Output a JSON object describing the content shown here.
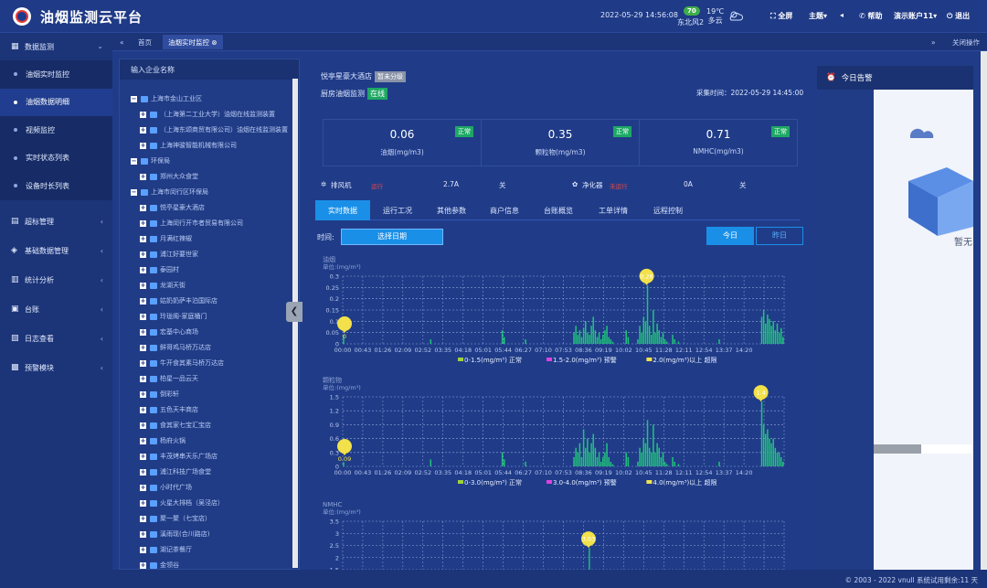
{
  "header": {
    "title": "油烟监测云平台",
    "datetime": "2022-05-29  14:56:08",
    "aqi": "70",
    "wind": "东北风2",
    "temperature": "19℃",
    "weather": "多云",
    "fullscreen": "全屏",
    "theme": "主题",
    "help": "帮助",
    "account": "演示账户11",
    "logout": "退出"
  },
  "sidebar": [
    {
      "label": "数据监测",
      "icon": "dashboard-icon",
      "expanded": true,
      "children": [
        "油烟实时监控",
        "油烟数据明细",
        "视频监控",
        "实时状态列表",
        "设备时长列表"
      ],
      "active_child": 1
    },
    {
      "label": "超标管理",
      "icon": "warning-icon"
    },
    {
      "label": "基础数据管理",
      "icon": "layers-icon"
    },
    {
      "label": "统计分析",
      "icon": "bar-chart-icon"
    },
    {
      "label": "台账",
      "icon": "ledger-icon"
    },
    {
      "label": "日志查看",
      "icon": "log-icon"
    },
    {
      "label": "预警模块",
      "icon": "alert-icon"
    }
  ],
  "tabs": {
    "home": "首页",
    "current": "油烟实时监控",
    "close_ops": "关闭操作"
  },
  "tree": {
    "placeholder": "输入企业名称",
    "nodes": [
      {
        "level": 0,
        "label": "上海市金山工业区",
        "type": "group"
      },
      {
        "level": 1,
        "label": "（上海第二工业大学）油烟在线监测装置"
      },
      {
        "level": 1,
        "label": "（上海东颂商贸有限公司）油烟在线监测装置"
      },
      {
        "level": 1,
        "label": "上海神骏智能机械有限公司"
      },
      {
        "level": 0,
        "label": "环保局",
        "type": "group"
      },
      {
        "level": 1,
        "label": "郑州大众食堂"
      },
      {
        "level": 0,
        "label": "上海市闵行区环保局",
        "type": "group"
      },
      {
        "level": 1,
        "label": "悦亭星豪大酒店"
      },
      {
        "level": 1,
        "label": "上海闵行开市者贸易有限公司"
      },
      {
        "level": 1,
        "label": "月满红辣椒"
      },
      {
        "level": 1,
        "label": "浦江好要世家"
      },
      {
        "level": 1,
        "label": "泰园村"
      },
      {
        "level": 1,
        "label": "龙湖天街"
      },
      {
        "level": 1,
        "label": "姑奶奶萨丰泊国际店"
      },
      {
        "level": 1,
        "label": "玲珑阁-家庭桶门"
      },
      {
        "level": 1,
        "label": "宏基中心商场"
      },
      {
        "level": 1,
        "label": "鲜哥鸡马桥万达店"
      },
      {
        "level": 1,
        "label": "牛开食其素马桥万达店"
      },
      {
        "level": 1,
        "label": "柏星一品云天"
      },
      {
        "level": 1,
        "label": "倒彩轩"
      },
      {
        "level": 1,
        "label": "五色天丰商店"
      },
      {
        "level": 1,
        "label": "食其家七宝汇宝店"
      },
      {
        "level": 1,
        "label": "杨府火锅"
      },
      {
        "level": 1,
        "label": "丰茂烤串天乐广场店"
      },
      {
        "level": 1,
        "label": "浦江科技广场食堂"
      },
      {
        "level": 1,
        "label": "小时代广场"
      },
      {
        "level": 1,
        "label": "火星大排档（吴泾店）"
      },
      {
        "level": 1,
        "label": "聚一聚（七宝店）"
      },
      {
        "level": 1,
        "label": "溪雨现(合川路店)"
      },
      {
        "level": 1,
        "label": "湖记茶餐厅"
      },
      {
        "level": 1,
        "label": "金领谷"
      }
    ]
  },
  "detail": {
    "site_name": "悦亭星豪大酒店",
    "site_badge": "暂未分级",
    "monitor_label": "厨房油烟监测",
    "monitor_status": "在线",
    "collect_time": "采集时间：2022-05-29 14:45:00",
    "metrics": [
      {
        "value": "0.06",
        "label": "油烟(mg/m3)",
        "status": "正常"
      },
      {
        "value": "0.35",
        "label": "颗粒物(mg/m3)",
        "status": "正常"
      },
      {
        "value": "0.71",
        "label": "NMHC(mg/m3)",
        "status": "正常"
      }
    ],
    "devices": {
      "fan_label": "排风机",
      "fan_status": "运行",
      "fan_current": "2.7A",
      "fan_switch": "关",
      "purifier_label": "净化器",
      "purifier_status": "未运行",
      "purifier_current": "0A",
      "purifier_switch": "关"
    },
    "tabs": [
      "实时数据",
      "运行工况",
      "其他参数",
      "商户信息",
      "台账概览",
      "工单详情",
      "远程控制"
    ],
    "time_label": "时间:",
    "date_button": "选择日期",
    "today": "今日",
    "yesterday": "昨日"
  },
  "alarm": {
    "title": "今日告警",
    "empty_text": "暂无"
  },
  "footer": {
    "copyright": "© 2003 - 2022  vnull   系统试用剩余:11 天"
  },
  "colors": {
    "bar": "#21c47c",
    "marker": "#f2e14a",
    "accent": "#1a8fe8"
  },
  "chart_data": [
    {
      "type": "bar",
      "title": "油烟",
      "ylabel": "单位:(mg/m³)",
      "ylim": [
        0,
        0.3
      ],
      "yticks": [
        "0.3",
        "0.25",
        "0.2",
        "0.15",
        "0.1",
        "0.05",
        "0"
      ],
      "categories": [
        "00:00",
        "00:43",
        "01:26",
        "02:09",
        "02:52",
        "03:35",
        "04:18",
        "05:01",
        "05:44",
        "06:27",
        "07:10",
        "07:53",
        "08:36",
        "09:19",
        "10:02",
        "10:45",
        "11:28",
        "12:11",
        "12:54",
        "13:37",
        "14:20"
      ],
      "max_label": "0.26",
      "min_label": "0",
      "legend": [
        {
          "label": "0-1.5(mg/m³) 正常",
          "color": "#9fd33c"
        },
        {
          "label": "1.5-2.0(mg/m³) 预警",
          "color": "#e040e0"
        },
        {
          "label": "2.0(mg/m³)以上 超限",
          "color": "#f2e14a"
        }
      ],
      "values": [
        0.04,
        0,
        0,
        0,
        0,
        0,
        0,
        0,
        0,
        0,
        0,
        0,
        0,
        0,
        0,
        0,
        0,
        0,
        0,
        0,
        0,
        0,
        0,
        0,
        0,
        0,
        0,
        0,
        0,
        0,
        0,
        0,
        0,
        0,
        0,
        0,
        0,
        0,
        0,
        0,
        0,
        0,
        0,
        0,
        0,
        0.02,
        0,
        0,
        0,
        0,
        0,
        0,
        0,
        0,
        0,
        0,
        0,
        0,
        0,
        0,
        0,
        0,
        0,
        0,
        0,
        0,
        0,
        0,
        0,
        0,
        0,
        0,
        0,
        0,
        0,
        0,
        0,
        0,
        0,
        0,
        0,
        0,
        0.06,
        0.03,
        0,
        0,
        0,
        0,
        0,
        0,
        0,
        0,
        0,
        0,
        0.02,
        0,
        0,
        0,
        0,
        0,
        0,
        0,
        0,
        0,
        0,
        0,
        0,
        0,
        0,
        0,
        0,
        0,
        0,
        0,
        0,
        0,
        0,
        0,
        0,
        0.05,
        0.08,
        0.04,
        0.06,
        0.03,
        0.07,
        0.1,
        0.05,
        0.04,
        0.08,
        0.12,
        0.06,
        0.03,
        0.05,
        0.02,
        0.04,
        0.06,
        0.08,
        0.03,
        0.02,
        0.01,
        0,
        0,
        0,
        0,
        0,
        0,
        0.06,
        0.03,
        0,
        0,
        0,
        0,
        0.02,
        0.08,
        0.05,
        0.12,
        0.1,
        0.26,
        0.08,
        0.04,
        0.15,
        0.05,
        0.09,
        0.06,
        0.03,
        0.05,
        0.02,
        0.01,
        0,
        0,
        0.04,
        0.02,
        0,
        0.01,
        0,
        0,
        0,
        0,
        0,
        0,
        0,
        0,
        0,
        0,
        0,
        0,
        0,
        0,
        0,
        0,
        0,
        0,
        0,
        0,
        0.02,
        0,
        0,
        0,
        0,
        0,
        0,
        0,
        0,
        0,
        0,
        0,
        0,
        0,
        0,
        0,
        0,
        0,
        0,
        0,
        0,
        0,
        0.12,
        0.15,
        0.09,
        0.13,
        0.11,
        0.08,
        0.1,
        0.06,
        0.09,
        0.05,
        0.07,
        0.03
      ]
    },
    {
      "type": "bar",
      "title": "颗粒物",
      "ylabel": "单位:(mg/m³)",
      "ylim": [
        0,
        1.5
      ],
      "yticks": [
        "1.5",
        "1.2",
        "0.9",
        "0.6",
        "0.3",
        "0"
      ],
      "categories": [
        "00:00",
        "00:43",
        "01:26",
        "02:09",
        "02:52",
        "03:35",
        "04:18",
        "05:01",
        "05:44",
        "06:27",
        "07:10",
        "07:53",
        "08:36",
        "09:19",
        "10:02",
        "10:45",
        "11:28",
        "12:11",
        "12:54",
        "13:37",
        "14:20"
      ],
      "max_label": "1.4",
      "min_label": "0.09",
      "legend": [
        {
          "label": "0-3.0(mg/m³) 正常",
          "color": "#9fd33c"
        },
        {
          "label": "3.0-4.0(mg/m³) 预警",
          "color": "#e040e0"
        },
        {
          "label": "4.0(mg/m³)以上 超限",
          "color": "#f2e14a"
        }
      ],
      "values": [
        0.09,
        0,
        0,
        0,
        0,
        0,
        0,
        0,
        0,
        0,
        0,
        0,
        0,
        0,
        0,
        0,
        0,
        0,
        0,
        0,
        0,
        0,
        0,
        0,
        0,
        0,
        0,
        0,
        0,
        0,
        0,
        0,
        0,
        0,
        0,
        0,
        0,
        0,
        0,
        0,
        0,
        0,
        0,
        0,
        0,
        0.15,
        0,
        0,
        0,
        0,
        0,
        0,
        0,
        0,
        0,
        0,
        0,
        0,
        0,
        0,
        0,
        0,
        0,
        0,
        0,
        0,
        0,
        0,
        0,
        0,
        0,
        0,
        0,
        0,
        0,
        0,
        0,
        0,
        0,
        0,
        0,
        0,
        0.3,
        0.15,
        0,
        0,
        0,
        0,
        0,
        0,
        0,
        0,
        0,
        0,
        0.1,
        0,
        0,
        0,
        0,
        0,
        0,
        0,
        0,
        0,
        0,
        0,
        0,
        0,
        0,
        0,
        0,
        0,
        0,
        0,
        0,
        0,
        0,
        0,
        0,
        0.2,
        0.4,
        0.3,
        0.5,
        0.2,
        0.8,
        0.4,
        0.6,
        0.3,
        0.5,
        0.7,
        0.4,
        0.2,
        0.3,
        0.1,
        0.2,
        0.3,
        0.5,
        0.2,
        0.1,
        0.05,
        0,
        0,
        0,
        0,
        0,
        0,
        0.3,
        0.2,
        0,
        0,
        0,
        0,
        0.1,
        0.4,
        0.3,
        0.6,
        0.5,
        1.0,
        0.4,
        0.3,
        0.9,
        0.3,
        0.5,
        0.4,
        0.2,
        0.3,
        0.1,
        0.05,
        0,
        0,
        0.2,
        0.1,
        0,
        0.05,
        0,
        0,
        0,
        0,
        0,
        0,
        0,
        0,
        0,
        0,
        0,
        0,
        0,
        0,
        0,
        0,
        0,
        0,
        0,
        0,
        0.1,
        0,
        0,
        0,
        0,
        0,
        0,
        0,
        0,
        0,
        0,
        0,
        0,
        0,
        0,
        0,
        0,
        0,
        0,
        0,
        0,
        0,
        1.4,
        0.9,
        0.7,
        0.8,
        0.6,
        0.5,
        0.6,
        0.4,
        0.3,
        0.3,
        0.2,
        0.1
      ]
    },
    {
      "type": "bar",
      "title": "NMHC",
      "ylabel": "单位:(mg/m³)",
      "ylim": [
        0,
        3.5
      ],
      "yticks": [
        "3.5",
        "3",
        "2.5",
        "2",
        "1.5"
      ],
      "max_label": "3.03",
      "values": [
        0,
        0,
        0,
        0,
        0,
        0,
        0,
        0,
        0,
        0,
        0,
        0,
        0,
        0,
        0,
        0,
        0,
        0,
        0,
        0,
        0,
        0,
        0,
        0,
        0,
        0,
        0,
        0,
        0,
        0,
        0,
        0,
        0,
        0,
        0,
        0,
        0,
        0,
        0,
        0,
        0,
        0,
        0,
        0,
        0,
        0,
        0,
        0,
        0,
        0,
        0,
        0,
        0,
        0,
        0,
        0,
        0,
        0,
        0,
        0,
        0,
        0,
        0,
        0,
        0,
        0,
        0,
        0,
        0,
        0,
        0,
        0,
        0,
        0,
        0,
        0,
        0,
        0,
        0,
        0,
        0,
        0,
        0,
        0,
        0,
        0,
        0,
        0,
        0,
        0,
        0,
        0,
        0,
        0,
        0,
        0,
        0,
        0,
        0,
        0,
        0,
        0,
        0,
        0,
        0,
        0,
        0,
        0,
        0,
        0,
        0,
        0,
        0,
        0,
        0,
        0,
        0,
        0,
        0,
        0,
        0,
        0,
        0,
        0,
        0,
        0,
        0,
        0,
        0,
        0,
        0,
        0,
        0,
        0,
        0,
        0,
        0,
        2.4,
        0,
        0,
        0,
        0,
        0,
        0,
        0,
        0,
        0,
        0,
        0,
        0,
        0,
        0,
        0,
        0,
        0,
        0,
        0,
        0,
        0,
        0,
        0,
        0,
        0,
        0,
        0,
        0,
        0,
        0,
        0,
        0,
        0,
        0,
        0,
        0,
        0,
        0,
        0,
        0,
        0,
        0,
        0,
        0,
        0,
        0,
        0,
        0,
        0,
        0,
        0,
        0,
        0,
        0,
        0,
        0,
        0,
        0,
        0,
        0,
        0,
        0,
        0,
        0,
        0,
        0,
        0,
        0,
        0,
        0,
        0,
        0,
        0,
        0,
        0,
        0,
        0,
        0,
        0,
        0,
        0,
        0,
        0,
        0,
        0,
        0,
        0,
        0,
        0,
        0,
        0,
        0,
        0,
        0,
        0,
        0,
        0,
        0,
        0,
        0,
        0,
        0,
        0,
        0,
        0,
        0,
        0,
        0
      ]
    }
  ]
}
